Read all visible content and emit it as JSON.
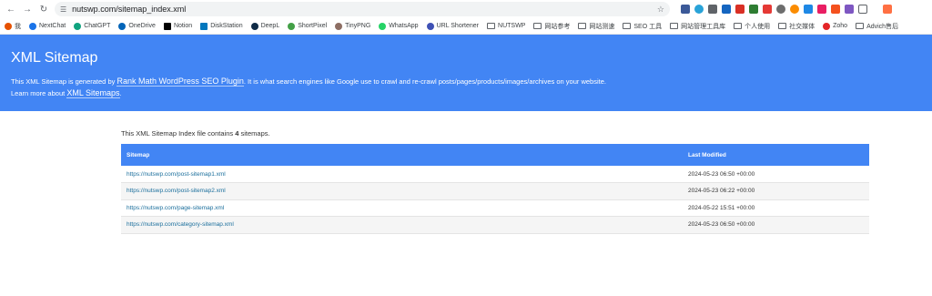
{
  "browser": {
    "url": "nutswp.com/sitemap_index.xml",
    "bookmarks": [
      "我",
      "NextChat",
      "ChatGPT",
      "OneDrive",
      "Notion",
      "DiskStation",
      "DeepL",
      "ShortPixel",
      "TinyPNG",
      "WhatsApp",
      "URL Shortener",
      "NUTSWP",
      "网站参考",
      "网站测速",
      "SEO 工具",
      "网站管理工具库",
      "个人使用",
      "社交媒体",
      "Zoho",
      "Advich售后"
    ]
  },
  "header": {
    "title": "XML Sitemap",
    "desc_prefix": "This XML Sitemap is generated by",
    "plugin_link": "Rank Math WordPress SEO Plugin",
    "desc_suffix": ". It is what search engines like Google use to crawl and re-crawl posts/pages/products/images/archives on your website.",
    "learn_prefix": "Learn more about",
    "learn_link": "XML Sitemaps",
    "learn_suffix": "."
  },
  "intro": {
    "prefix": "This XML Sitemap Index file contains",
    "count": "4",
    "suffix": "sitemaps."
  },
  "table": {
    "col_sitemap": "Sitemap",
    "col_modified": "Last Modified",
    "rows": [
      {
        "url": "https://nutswp.com/post-sitemap1.xml",
        "modified": "2024-05-23 06:50 +00:00"
      },
      {
        "url": "https://nutswp.com/post-sitemap2.xml",
        "modified": "2024-05-23 06:22 +00:00"
      },
      {
        "url": "https://nutswp.com/page-sitemap.xml",
        "modified": "2024-05-22 15:51 +00:00"
      },
      {
        "url": "https://nutswp.com/category-sitemap.xml",
        "modified": "2024-05-23 06:50 +00:00"
      }
    ]
  },
  "colors": {
    "accent": "#4285f4",
    "link": "#1a6e9c"
  }
}
